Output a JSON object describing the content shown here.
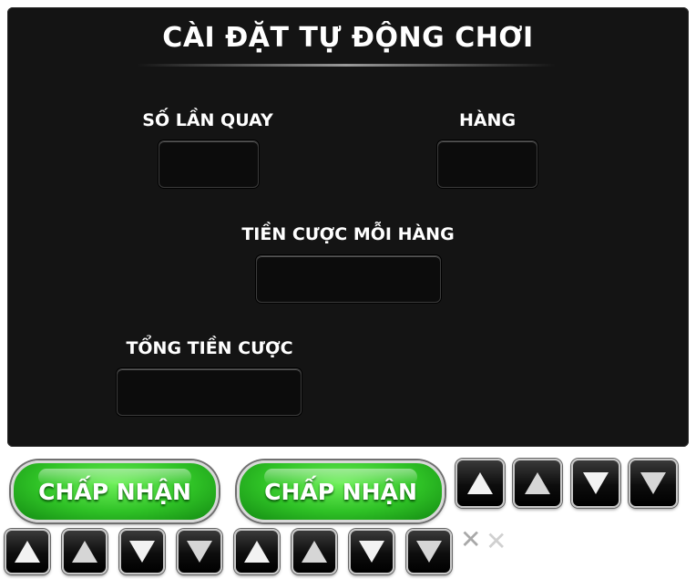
{
  "dialog": {
    "title": "CÀI ĐẶT TỰ ĐỘNG CHƠI",
    "fields": {
      "spins_label": "SỐ LẦN QUAY",
      "spins_value": "",
      "lines_label": "HÀNG",
      "lines_value": "",
      "bet_per_line_label": "TIỀN CƯỢC MỖI HÀNG",
      "bet_per_line_value": "",
      "total_bet_label": "TỔNG TIỀN CƯỢC",
      "total_bet_value": ""
    }
  },
  "buttons": {
    "accept_label": "CHẤP NHẬN",
    "accept_pressed_label": "CHẤP NHẬN",
    "up_icon": "arrow-up-icon",
    "down_icon": "arrow-down-icon",
    "close_icon": "close-icon",
    "close_symbol": "✕",
    "colors": {
      "accept_green": "#2fc226",
      "panel_bg": "#141414"
    }
  }
}
